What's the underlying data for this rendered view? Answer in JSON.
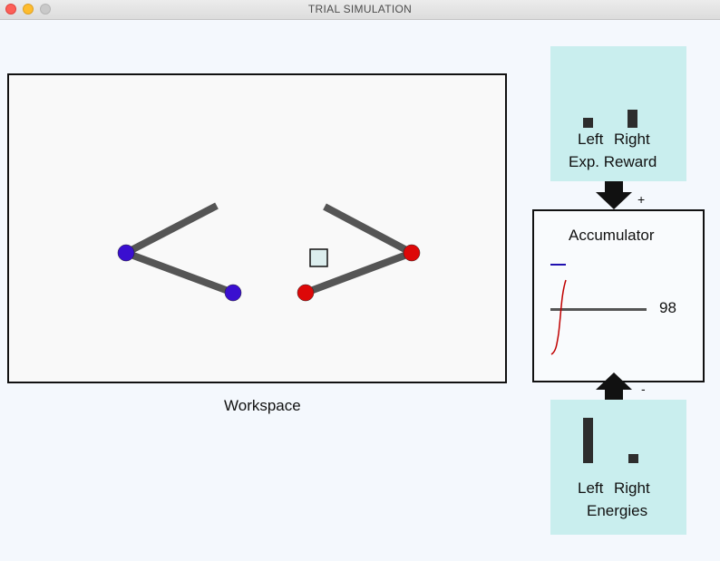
{
  "window": {
    "title": "TRIAL SIMULATION"
  },
  "workspace": {
    "label": "Workspace"
  },
  "reward_panel": {
    "left_label": "Left",
    "right_label": "Right",
    "caption": "Exp. Reward",
    "left_value": 0.4,
    "right_value": 0.7
  },
  "energy_panel": {
    "left_label": "Left",
    "right_label": "Right",
    "caption": "Energies",
    "left_value": 1.0,
    "right_value": 0.2
  },
  "accumulator": {
    "title": "Accumulator",
    "value": "98",
    "plus_sign": "+",
    "minus_sign": "-"
  },
  "colors": {
    "left_joint": "#3a0fd0",
    "right_joint": "#dd0808",
    "arm": "#555555",
    "panel": "#c9eeee",
    "trace": "#c00000"
  }
}
